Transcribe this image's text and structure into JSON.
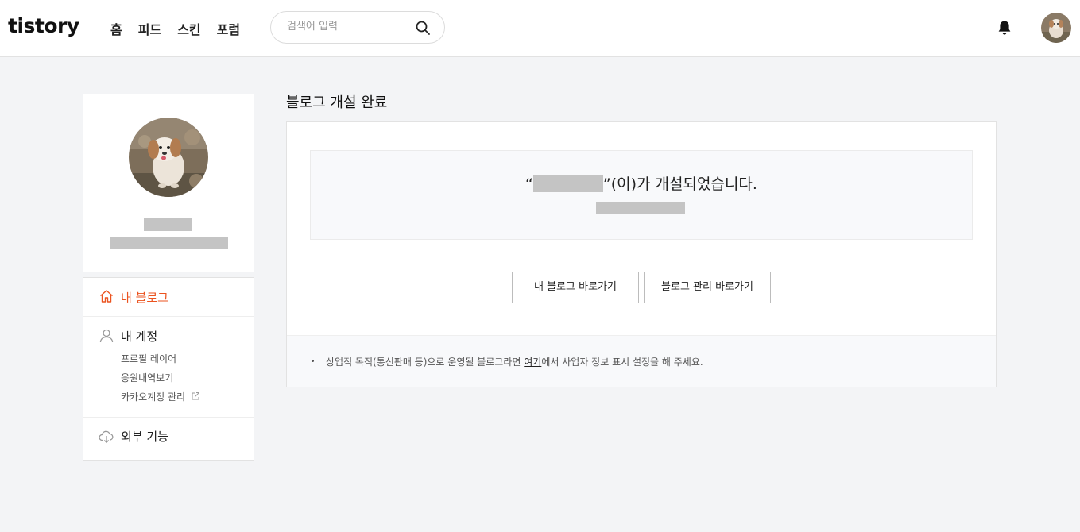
{
  "header": {
    "logo": "tistory",
    "nav": [
      "홈",
      "피드",
      "스킨",
      "포럼"
    ],
    "search_placeholder": "검색어 입력"
  },
  "sidebar": {
    "menu": {
      "my_blog": "내 블로그",
      "my_account": "내 계정",
      "account_links": [
        "프로필 레이어",
        "응원내역보기",
        "카카오계정 관리"
      ],
      "external": "외부 기능"
    }
  },
  "main": {
    "title": "블로그 개설 완료",
    "created_prefix": "“",
    "created_suffix": "”(이)가 개설되었습니다.",
    "btn_go_blog": "내 블로그 바로가기",
    "btn_go_manage": "블로그 관리 바로가기",
    "note_before": "상업적 목적(통신판매 등)으로 운영될 블로그라면 ",
    "note_link": "여기",
    "note_after": "에서 사업자 정보 표시 설정을 해 주세요."
  },
  "colors": {
    "accent": "#eb531f",
    "background": "#f3f4f6"
  }
}
